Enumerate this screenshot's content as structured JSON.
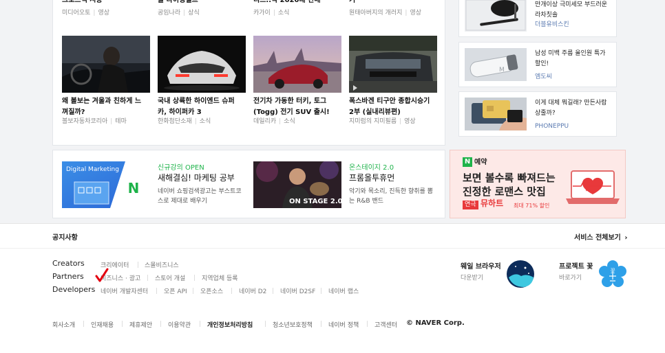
{
  "top_row": [
    {
      "title": "크로스백 시승",
      "source": "미디어오토",
      "category": "영상"
    },
    {
      "title": "줄 타이밍벨트",
      "source": "공임나라",
      "category": "상식"
    },
    {
      "title": "티드..딱 2020대 판매",
      "source": "카가이",
      "category": "소식"
    },
    {
      "title": "기",
      "source": "원태아버지의 개러지",
      "category": "영상"
    }
  ],
  "articles": [
    {
      "title": "왜 볼보는 겨울과 친하게 느껴질까?",
      "source": "볼보자동차코리아",
      "category": "테마"
    },
    {
      "title": "국내 상륙한 하이엔드 슈퍼카, 하이퍼카 3",
      "source": "한화첨단소재",
      "category": "소식"
    },
    {
      "title": "전기차 가동한 터키, 토그(Togg) 전기 SUV 출시!",
      "source": "데일리카",
      "category": "소식"
    },
    {
      "title": "폭스바겐 티구안 종합시승기 2부 (실내리뷰편)",
      "source": "지미럼의 지미필름",
      "category": "영상"
    }
  ],
  "shopping": [
    {
      "text": "만개이상 극미세모 부드러운 라차칫솔",
      "brand": "더블유비스킨"
    },
    {
      "text": "남성 미백 주름 올인원 특가할인!",
      "brand": "엠도씨"
    },
    {
      "text": "이게 대체 뭐길래? 만든사람 상줄까?",
      "brand": "PHONEPPU"
    }
  ],
  "promos": [
    {
      "kicker": "신규강의 OPEN",
      "title": "새해결심! 마케팅 공부",
      "desc": "네이버 쇼핑검색광고는 부스트코스로 제대로 배우기",
      "thumb_label": "Digital Marketing"
    },
    {
      "kicker": "온스테이지 2.0",
      "title": "프롬올투휴먼",
      "desc": "악기와 목소리, 진득한 향취를 뽐는 R&B 밴드",
      "thumb_label": "ON STAGE 2.0"
    }
  ],
  "ad": {
    "badge_letter": "N",
    "badge_text": "예약",
    "line1": "보면 볼수록 빠져드는",
    "line2": "진정한 로맨스 맛집",
    "tag1": "연극",
    "tag2": "뮤하트",
    "discount": "최대 71% 할인"
  },
  "footer": {
    "notice": "공지사항",
    "all_services": "서비스 전체보기",
    "rows": [
      {
        "label": "Creators",
        "links": [
          "크리에이터",
          "스몰비즈니스"
        ]
      },
      {
        "label": "Partners",
        "links": [
          "비즈니스 · 광고",
          "스토어 개설",
          "지역업체 등록"
        ]
      },
      {
        "label": "Developers",
        "links": [
          "네이버 개발자센터",
          "오픈 API",
          "오픈소스",
          "네이버 D2",
          "네이버 D2SF",
          "네이버 랩스"
        ]
      }
    ],
    "whale": {
      "title": "웨일 브라우저",
      "action": "다운받기"
    },
    "kkot": {
      "title": "프로젝트 꽃",
      "action": "바로가기",
      "logo_text": "꽃"
    },
    "bottom": [
      "회사소개",
      "인재채용",
      "제휴제안",
      "이용약관",
      "개인정보처리방침",
      "청소년보호정책",
      "네이버 정책",
      "고객센터"
    ],
    "copyright": "© NAVER Corp."
  },
  "colors": {
    "green": "#1eb34a",
    "brand_link": "#5a7ab0",
    "ad_red": "#e8393b"
  }
}
